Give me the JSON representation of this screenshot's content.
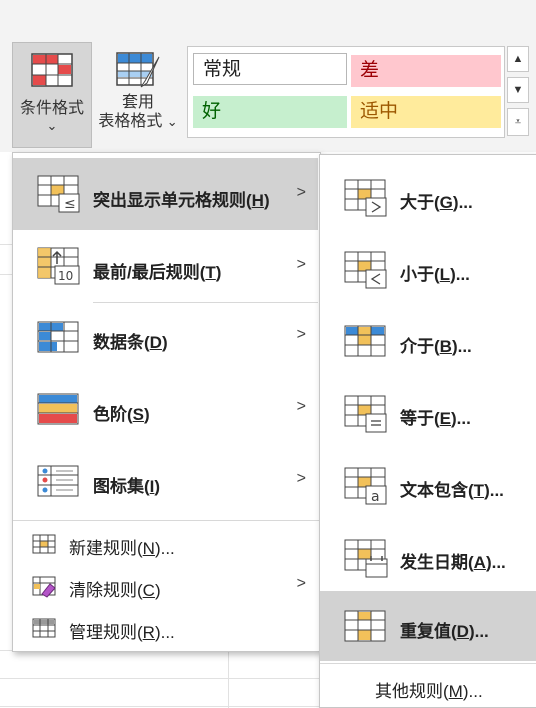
{
  "ribbon": {
    "conditional_format": {
      "line1": "条件格式",
      "line2": "⌄"
    },
    "table_format": {
      "line1": "套用",
      "line2": "表格格式",
      "dropdown": "⌄"
    },
    "styles": {
      "normal": "常规",
      "bad": "差",
      "good": "好",
      "neutral": "适中"
    }
  },
  "colors": {
    "bad_bg": "#ffc7ce",
    "bad_fg": "#9c0006",
    "good_bg": "#c6efce",
    "good_fg": "#006100",
    "neutral_bg": "#ffeb9c",
    "neutral_fg": "#9c5700",
    "highlight": "#d2d2d2"
  },
  "main_menu": {
    "items": [
      {
        "label": "突出显示单元格规则(",
        "key": "H",
        "suffix": ")",
        "icon": "highlight-rules-icon"
      },
      {
        "label": "最前/最后规则(",
        "key": "T",
        "suffix": ")",
        "icon": "top-bottom-rules-icon"
      },
      {
        "label": "数据条(",
        "key": "D",
        "suffix": ")",
        "icon": "data-bars-icon"
      },
      {
        "label": "色阶(",
        "key": "S",
        "suffix": ")",
        "icon": "color-scales-icon"
      },
      {
        "label": "图标集(",
        "key": "I",
        "suffix": ")",
        "icon": "icon-sets-icon"
      }
    ],
    "small_items": [
      {
        "label": "新建规则(",
        "key": "N",
        "suffix": ")..."
      },
      {
        "label": "清除规则(",
        "key": "C",
        "suffix": ")"
      },
      {
        "label": "管理规则(",
        "key": "R",
        "suffix": ")..."
      }
    ]
  },
  "sub_menu": {
    "items": [
      {
        "label": "大于(",
        "key": "G",
        "suffix": ")..."
      },
      {
        "label": "小于(",
        "key": "L",
        "suffix": ")..."
      },
      {
        "label": "介于(",
        "key": "B",
        "suffix": ")..."
      },
      {
        "label": "等于(",
        "key": "E",
        "suffix": ")..."
      },
      {
        "label": "文本包含(",
        "key": "T",
        "suffix": ")..."
      },
      {
        "label": "发生日期(",
        "key": "A",
        "suffix": ")..."
      },
      {
        "label": "重复值(",
        "key": "D",
        "suffix": ")..."
      }
    ],
    "more": {
      "label": "其他规则(",
      "key": "M",
      "suffix": ")..."
    }
  }
}
